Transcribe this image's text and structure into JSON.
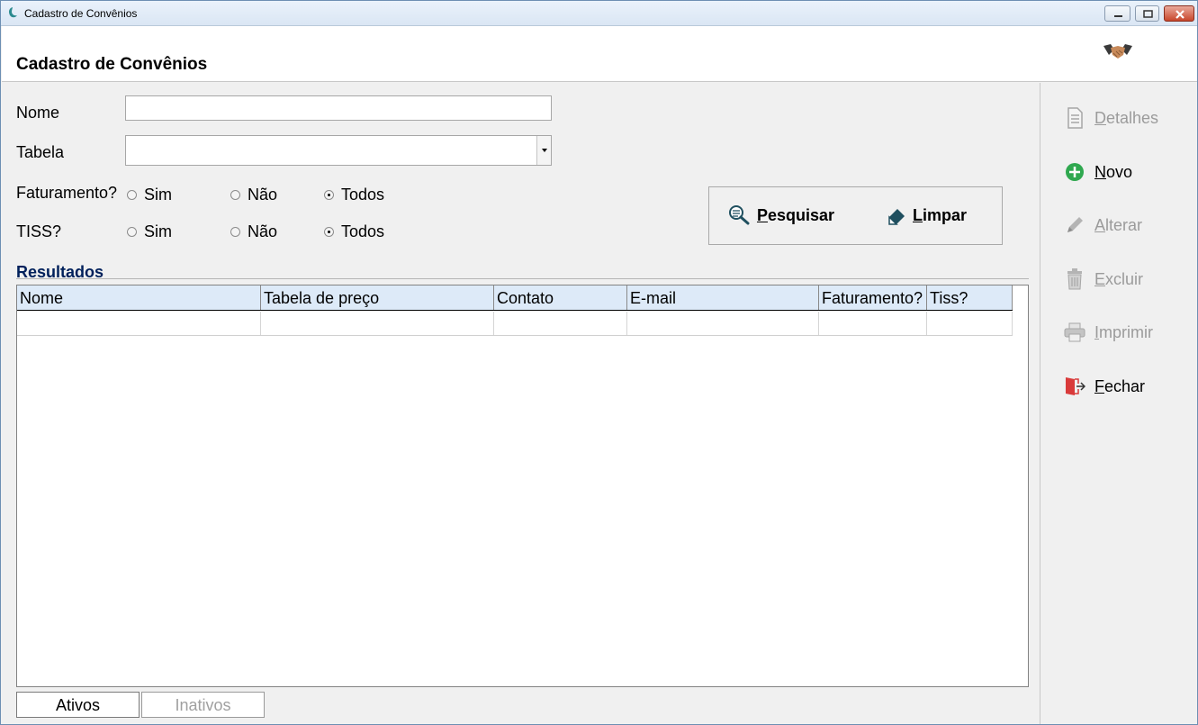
{
  "window": {
    "title": "Cadastro de Convênios",
    "controls": [
      "minimize",
      "maximize",
      "close"
    ]
  },
  "header": {
    "title": "Cadastro de Convênios",
    "icon": "handshake-icon"
  },
  "form": {
    "nome_label": "Nome",
    "nome_value": "",
    "tabela_label": "Tabela",
    "tabela_value": "",
    "faturamento_label": "Faturamento?",
    "tiss_label": "TISS?",
    "options": {
      "sim": "Sim",
      "nao": "Não",
      "todos": "Todos"
    },
    "faturamento_selected": "Todos",
    "tiss_selected": "Todos"
  },
  "actions": {
    "pesquisar_first": "P",
    "pesquisar_rest": "esquisar",
    "limpar_first": "L",
    "limpar_rest": "impar"
  },
  "results": {
    "title": "Resultados",
    "columns": [
      "Nome",
      "Tabela de preço",
      "Contato",
      "E-mail",
      "Faturamento?",
      "Tiss?"
    ],
    "rows": [
      [
        "",
        "",
        "",
        "",
        "",
        ""
      ]
    ]
  },
  "tabs": {
    "ativos": "Ativos",
    "inativos": "Inativos"
  },
  "sidebar": {
    "items": [
      {
        "first": "D",
        "rest": "etalhes",
        "icon": "document-icon",
        "enabled": false
      },
      {
        "first": "N",
        "rest": "ovo",
        "icon": "plus-circle-icon",
        "enabled": true
      },
      {
        "first": "A",
        "rest": "lterar",
        "icon": "pencil-icon",
        "enabled": false
      },
      {
        "first": "E",
        "rest": "xcluir",
        "icon": "trash-icon",
        "enabled": false
      },
      {
        "first": "I",
        "rest": "mprimir",
        "icon": "printer-icon",
        "enabled": false
      },
      {
        "first": "F",
        "rest": "echar",
        "icon": "exit-door-icon",
        "enabled": true
      }
    ]
  },
  "colors": {
    "results_title": "#00205b",
    "grid_header_bg": "#ddeaf8",
    "novo_icon": "#2fa84f",
    "fechar_icon": "#d93a3a"
  }
}
